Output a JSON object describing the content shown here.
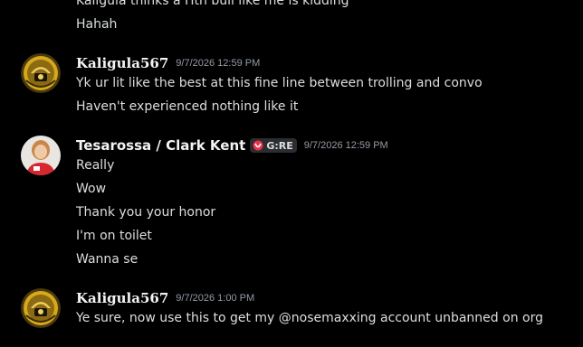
{
  "messages": [
    {
      "lines": [
        "Kaligula thinks a Htn bull like me is kidding",
        "Hahah"
      ]
    },
    {
      "username": "Kaligula567",
      "timestamp": "9/7/2026 12:59 PM",
      "lines": [
        "Yk ur lit like the best at this fine line between trolling and convo",
        "Haven't experienced nothing like it"
      ]
    },
    {
      "username": "Tesarossa / Clark Kent",
      "tag": "G:RE",
      "timestamp": "9/7/2026 12:59 PM",
      "lines": [
        "Really",
        "Wow",
        "Thank you your honor",
        "I'm on toilet",
        "Wanna se"
      ]
    },
    {
      "username": "Kaligula567",
      "timestamp": "9/7/2026 1:00 PM",
      "lines": [
        "Ye sure, now use this to get my @nosemaxxing account unbanned on org"
      ]
    }
  ],
  "colors": {
    "background": "#000000",
    "text": "#dbdee1",
    "username": "#f2f3f5",
    "timestamp": "#949ba4",
    "tag_background": "#2b2d31",
    "tag_icon": "#e8324a"
  }
}
